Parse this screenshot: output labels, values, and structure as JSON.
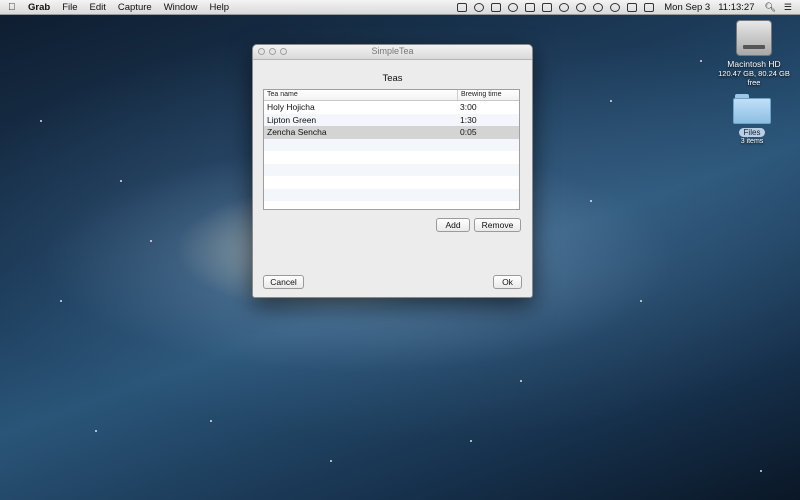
{
  "menubar": {
    "app_name": "Grab",
    "menus": [
      "File",
      "Edit",
      "Capture",
      "Window",
      "Help"
    ],
    "date": "Mon Sep 3",
    "time": "11:13:27"
  },
  "desktop": {
    "hd": {
      "name": "Macintosh HD",
      "info": "120.47 GB, 80.24 GB free"
    },
    "folder": {
      "name": "Files",
      "info": "3 items"
    }
  },
  "window": {
    "title": "SimpleTea",
    "heading": "Teas",
    "columns": [
      "Tea name",
      "Brewing time"
    ],
    "rows": [
      {
        "name": "Holy Hojicha",
        "time": "3:00"
      },
      {
        "name": "Lipton Green",
        "time": "1:30"
      },
      {
        "name": "Zencha Sencha",
        "time": "0:05"
      }
    ],
    "add_label": "Add",
    "remove_label": "Remove",
    "cancel_label": "Cancel",
    "ok_label": "Ok"
  }
}
